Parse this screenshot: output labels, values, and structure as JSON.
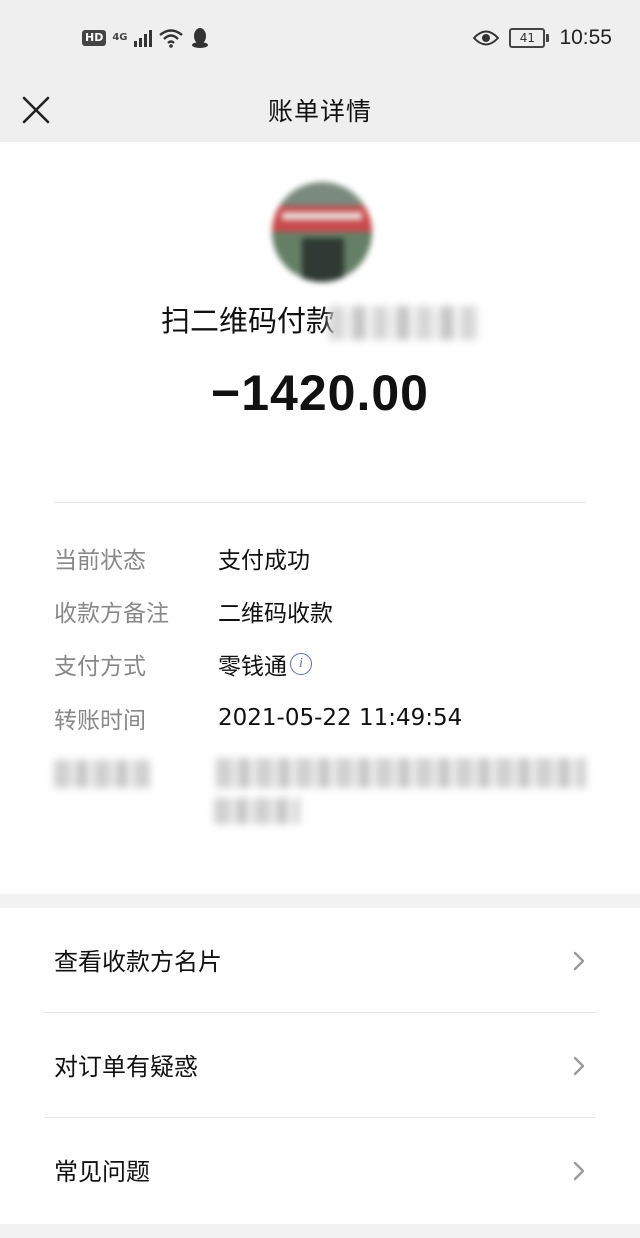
{
  "status_bar": {
    "hd": "HD",
    "network": "4G",
    "battery": "41",
    "time": "10:55"
  },
  "nav": {
    "title": "账单详情",
    "close_icon": "close-icon"
  },
  "detail": {
    "merchant_label": "扫二维码付款",
    "amount": "−1420.00",
    "rows": [
      {
        "label": "当前状态",
        "value": "支付成功"
      },
      {
        "label": "收款方备注",
        "value": "二维码收款"
      },
      {
        "label": "支付方式",
        "value": "零钱通"
      },
      {
        "label": "转账时间",
        "value": "2021-05-22 11:49:54"
      }
    ],
    "info_icon": "info-icon"
  },
  "menu": {
    "items": [
      {
        "label": "查看收款方名片"
      },
      {
        "label": "对订单有疑惑"
      },
      {
        "label": "常见问题"
      }
    ],
    "chevron_icon": "chevron-right-icon"
  },
  "colors": {
    "page_bg": "#f2f2f2",
    "card_bg": "#ffffff",
    "label_gray": "#888888",
    "info_blue": "#5b6fb0"
  }
}
